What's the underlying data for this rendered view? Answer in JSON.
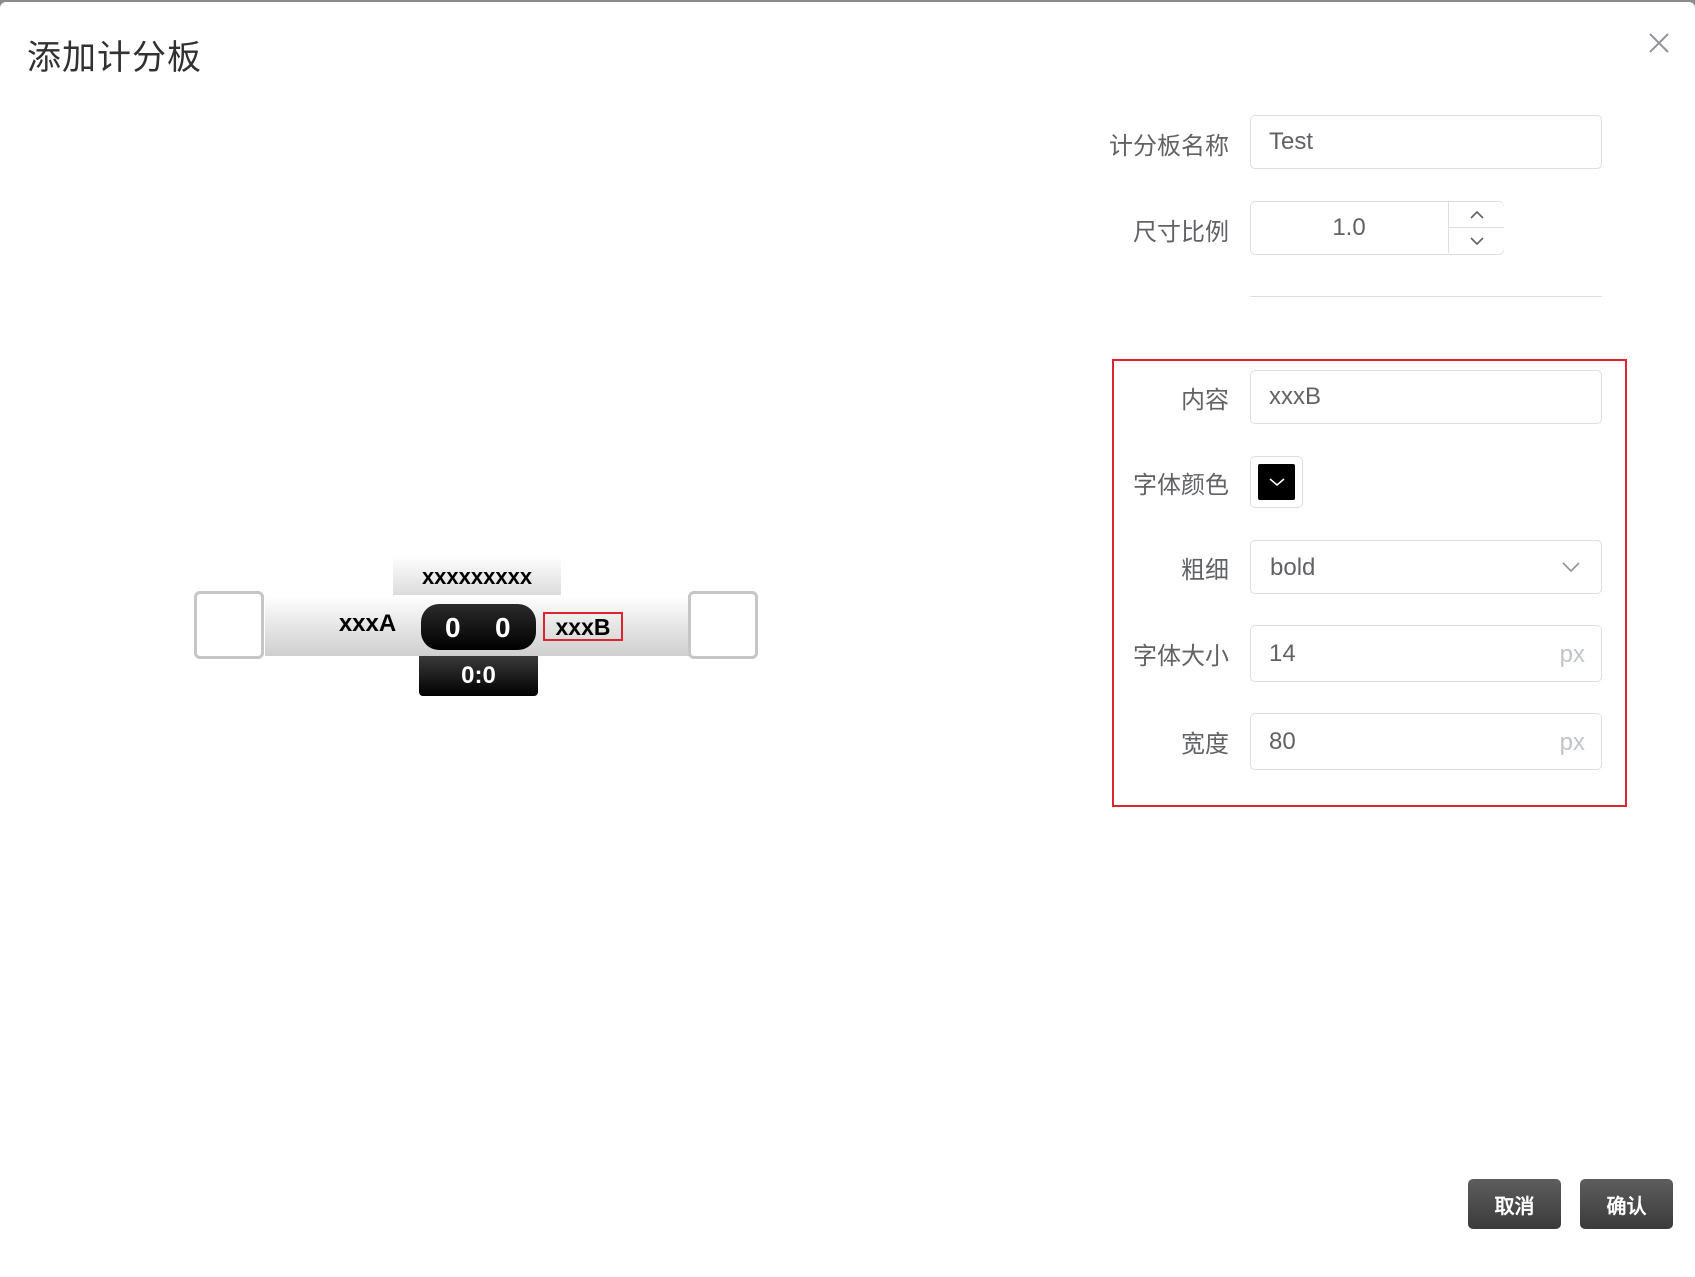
{
  "dialog": {
    "title": "添加计分板"
  },
  "preview": {
    "top_label": "xxxxxxxxx",
    "team_a": "xxxA",
    "team_b": "xxxB",
    "score_a": "0",
    "score_b": "0",
    "time": "0:0"
  },
  "form": {
    "name_label": "计分板名称",
    "name_value": "Test",
    "scale_label": "尺寸比例",
    "scale_value": "1.0",
    "content_label": "内容",
    "content_value": "xxxB",
    "font_color_label": "字体颜色",
    "font_color_value": "#000000",
    "weight_label": "粗细",
    "weight_value": "bold",
    "font_size_label": "字体大小",
    "font_size_value": "14",
    "font_size_unit": "px",
    "width_label": "宽度",
    "width_value": "80",
    "width_unit": "px"
  },
  "buttons": {
    "cancel": "取消",
    "confirm": "确认"
  },
  "colors": {
    "highlight": "#e0242c",
    "button": "#4a4a4a"
  },
  "icons": [
    "close-icon",
    "chevron-up-icon",
    "chevron-down-icon"
  ]
}
